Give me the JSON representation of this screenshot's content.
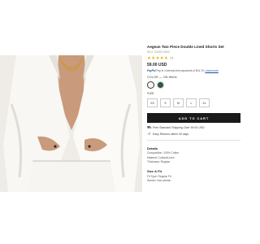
{
  "product": {
    "title": "Aegean Two Piece Double Lined Shorts Set",
    "sku": "SKU: C0062-9543",
    "stars": "★★★★★",
    "review_count": "77",
    "price": "59.00 USD",
    "paypal_brand": "PayPal",
    "paypal_text": "Pay in 4 interest-free payments of $14.75.",
    "paypal_link": "Learn more",
    "color_label": "COLOR — Off-White",
    "size_label": "SIZE",
    "sizes": [
      "XS",
      "S",
      "M",
      "L",
      "XL"
    ],
    "add_to_cart": "ADD TO CART",
    "shipping": "Free Standard Shipping Over 99.00 USD",
    "returns": "Easy Returns within 30 days",
    "details_title": "Details",
    "details": [
      "Composition: 100% Cotton",
      "Material: Cotton&Linen",
      "Thickness: Regular"
    ],
    "fit_title": "Size & Fit",
    "fit": [
      "Fit Type: Regular Fit",
      "Stretch: Non-stretch"
    ]
  },
  "colors": {
    "accent": "#1a1a1a",
    "stars": "#e6b422",
    "swatch_white": "#f6f4ee",
    "swatch_green": "#2f5a3c",
    "paypal": "#1f4c9a"
  },
  "icons": {
    "shipping": "truck-icon",
    "returns": "return-arrow-icon"
  }
}
